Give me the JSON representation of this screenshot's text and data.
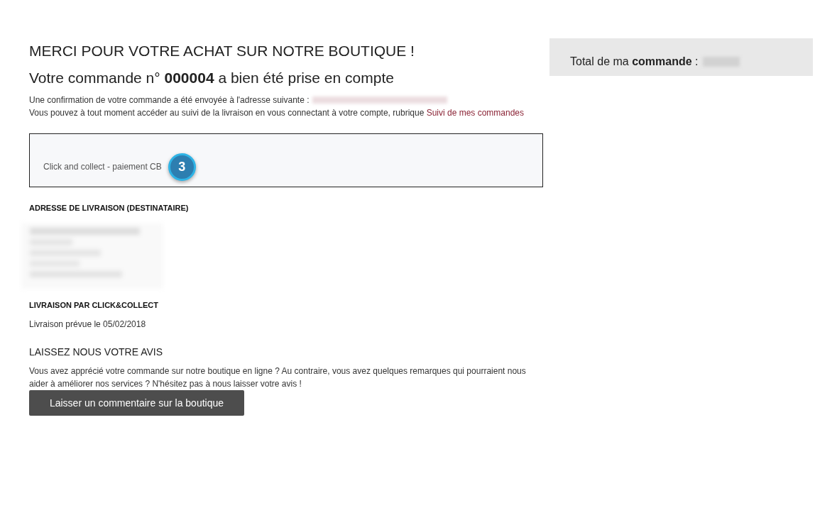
{
  "header": {
    "title": "MERCI POUR VOTRE ACHAT SUR NOTRE BOUTIQUE !",
    "order_line": "Votre commande n° **000004** a bien été prise en compte"
  },
  "confirmation": {
    "email_text": "Une confirmation de votre commande a été envoyée à l'adresse suivante :",
    "tracking_text": "Vous pouvez à tout moment accéder au suivi de la livraison en vous connectant à votre compte, rubrique",
    "tracking_link": "Suivi de mes commandes"
  },
  "payment_box": {
    "method": "Click and collect - paiement CB",
    "step_badge": "3"
  },
  "delivery_address": {
    "heading": "ADRESSE DE LIVRAISON (DESTINATAIRE)"
  },
  "shipping": {
    "heading": "LIVRAISON PAR CLICK&COLLECT",
    "date_text": "Livraison prévue le 05/02/2018"
  },
  "review": {
    "heading": "LAISSEZ NOUS VOTRE AVIS",
    "text": "Vous avez apprécié votre commande sur notre boutique en ligne ? Au contraire, vous avez quelques remarques qui pourraient nous aider à améliorer nos services ? N'hésitez pas à nous laisser votre avis !",
    "button": "Laisser un commentaire sur la boutique"
  },
  "summary": {
    "total_label": "Total de ma **commande** :"
  }
}
